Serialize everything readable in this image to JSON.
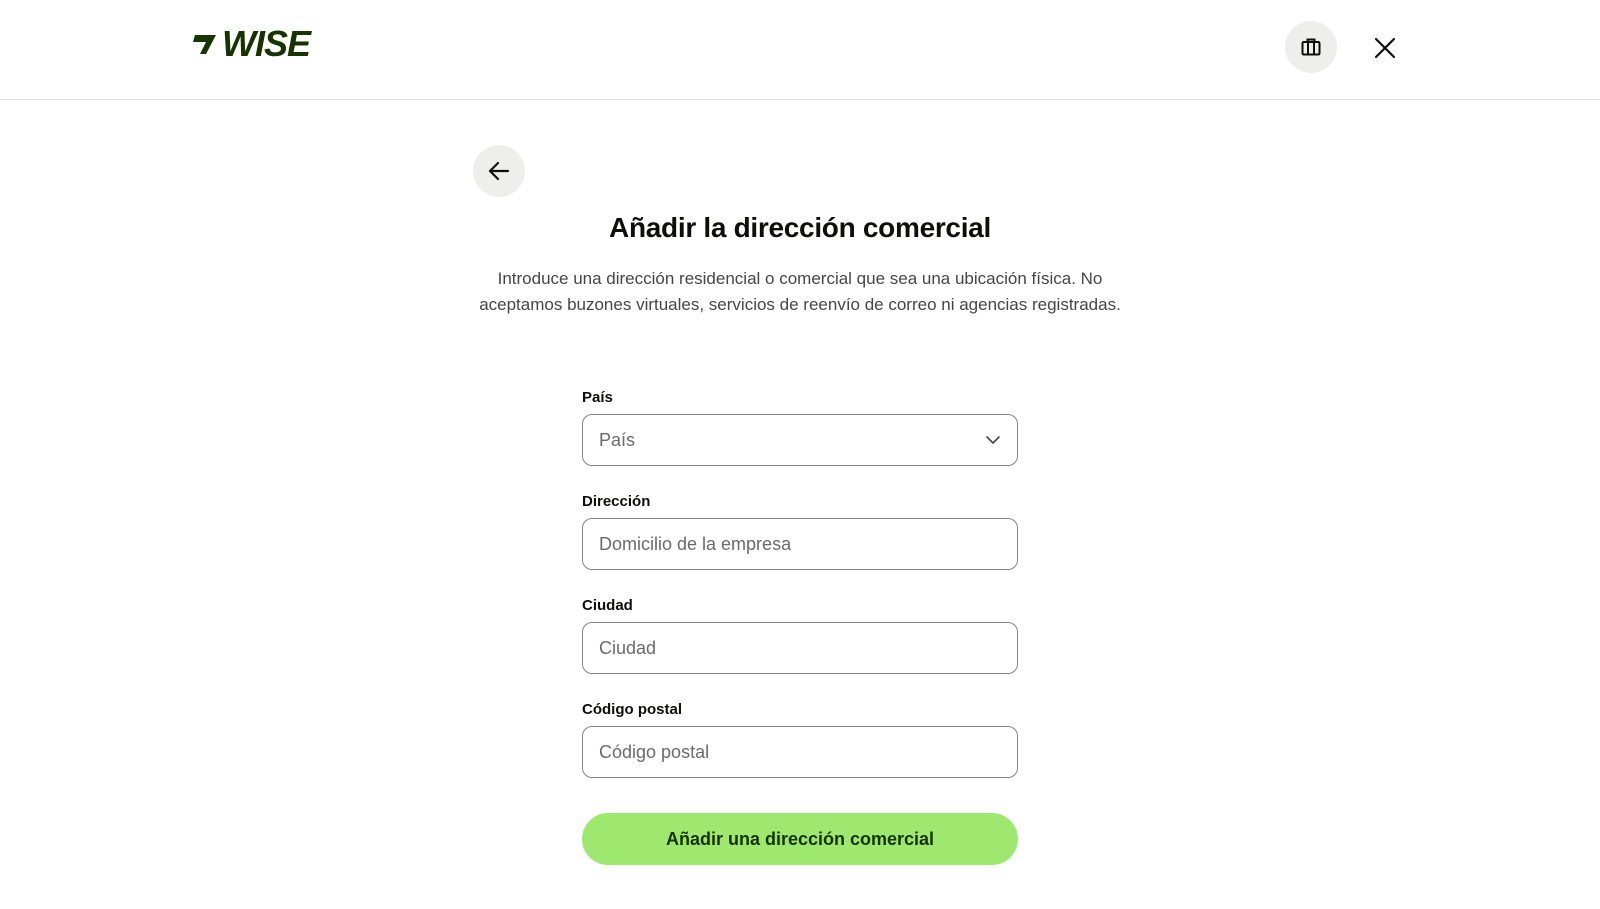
{
  "brand": {
    "logo_text": "WISE",
    "logo_color": "#163300",
    "accent_color": "#9fe870"
  },
  "header": {
    "business_icon": "briefcase-icon",
    "close_icon": "close-icon"
  },
  "page": {
    "back_icon": "arrow-left-icon",
    "title": "Añadir la dirección comercial",
    "subtitle": "Introduce una dirección residencial o comercial que sea una ubicación física. No aceptamos buzones virtuales, servicios de reenvío de correo ni agencias registradas."
  },
  "form": {
    "country": {
      "label": "País",
      "placeholder": "País",
      "icon": "chevron-down-icon"
    },
    "address": {
      "label": "Dirección",
      "placeholder": "Domicilio de la empresa"
    },
    "city": {
      "label": "Ciudad",
      "placeholder": "Ciudad"
    },
    "postal_code": {
      "label": "Código postal",
      "placeholder": "Código postal"
    },
    "submit_label": "Añadir una dirección comercial"
  }
}
